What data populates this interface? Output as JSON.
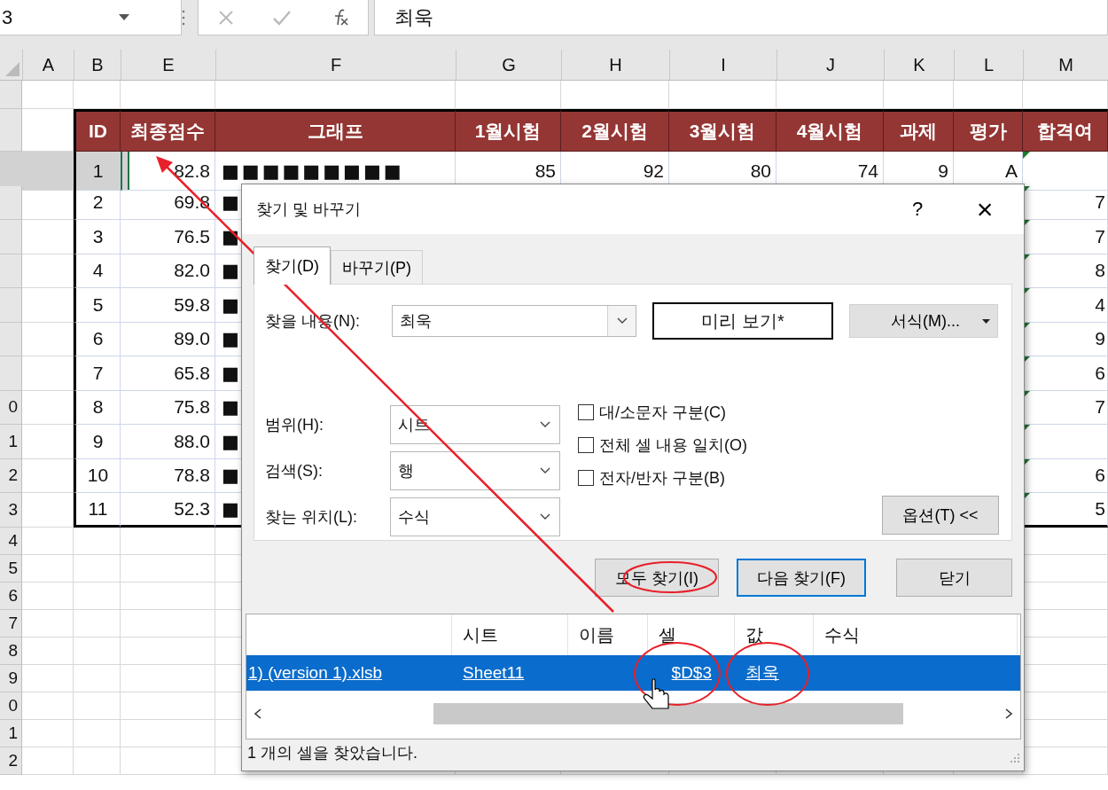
{
  "formula_bar": {
    "name_box": "3",
    "formula": "최욱"
  },
  "column_headers": [
    "A",
    "B",
    "E",
    "F",
    "G",
    "H",
    "I",
    "J",
    "K",
    "L",
    "M"
  ],
  "table": {
    "columns": [
      "ID",
      "최종점수",
      "그래프",
      "1월시험",
      "2월시험",
      "3월시험",
      "4월시험",
      "과제",
      "평가",
      "합격여"
    ],
    "rows": [
      {
        "active": true,
        "error_flag": true,
        "cells": [
          "1",
          "82.8",
          "■■■■■■■■■",
          "85",
          "92",
          "80",
          "74",
          "9",
          "A"
        ]
      },
      {
        "error_flag": true,
        "cells": [
          "2",
          "69.8",
          "■"
        ],
        "tail": "7"
      },
      {
        "error_flag": true,
        "cells": [
          "3",
          "76.5",
          "■"
        ],
        "tail": "7"
      },
      {
        "error_flag": true,
        "cells": [
          "4",
          "82.0",
          "■"
        ],
        "tail": "8"
      },
      {
        "error_flag": true,
        "cells": [
          "5",
          "59.8",
          "■"
        ],
        "tail": "4"
      },
      {
        "error_flag": true,
        "cells": [
          "6",
          "89.0",
          "■"
        ],
        "tail": "9"
      },
      {
        "error_flag": true,
        "cells": [
          "7",
          "65.8",
          "■"
        ],
        "tail": "6"
      },
      {
        "row_number": "0",
        "error_flag": true,
        "cells": [
          "8",
          "75.8",
          "■"
        ],
        "tail": "7"
      },
      {
        "row_number": "1",
        "error_flag": true,
        "cells": [
          "9",
          "88.0",
          "■"
        ]
      },
      {
        "row_number": "2",
        "error_flag": true,
        "cells": [
          "10",
          "78.8",
          "■"
        ],
        "tail": "6"
      },
      {
        "row_number": "3",
        "error_flag": true,
        "cells": [
          "11",
          "52.3",
          "■"
        ],
        "tail": "5"
      }
    ]
  },
  "empty_rows": [
    {
      "row_number": "4"
    },
    {
      "row_number": "5"
    },
    {
      "row_number": "6"
    },
    {
      "row_number": "7"
    },
    {
      "row_number": "8"
    },
    {
      "row_number": "9"
    },
    {
      "row_number": "0"
    },
    {
      "row_number": "1"
    },
    {
      "row_number": "2"
    }
  ],
  "dialog": {
    "title": "찾기 및 바꾸기",
    "help": "?",
    "close": "×",
    "tabs": [
      {
        "label": "찾기(D)",
        "selected": true
      },
      {
        "label": "바꾸기(P)",
        "selected": false
      }
    ],
    "find_label": "찾을 내용(N):",
    "find_value": "최욱",
    "preview": "미리 보기*",
    "format_button": "서식(M)...",
    "selects": [
      {
        "label": "범위(H):",
        "value": "시트"
      },
      {
        "label": "검색(S):",
        "value": "행"
      },
      {
        "label": "찾는 위치(L):",
        "value": "수식"
      }
    ],
    "checkboxes": [
      {
        "label": "대/소문자 구분(C)",
        "checked": false
      },
      {
        "label": "전체 셀 내용 일치(O)",
        "checked": false
      },
      {
        "label": "전자/반자 구분(B)",
        "checked": false
      }
    ],
    "options_button": "옵션(T) <<",
    "buttons": [
      {
        "label": "모두 찾기(I)",
        "default": false
      },
      {
        "label": "다음 찾기(F)",
        "default": true
      },
      {
        "label": "닫기",
        "default": false
      }
    ],
    "results": {
      "columns": [
        "",
        "시트",
        "이름",
        "셀",
        "값",
        "수식"
      ],
      "rows": [
        {
          "selected": true,
          "cells": [
            "1) (version 1).xlsb",
            "Sheet11",
            "",
            "$D$3",
            "최욱",
            ""
          ]
        }
      ]
    },
    "status": "1 개의 셀을 찾았습니다."
  }
}
